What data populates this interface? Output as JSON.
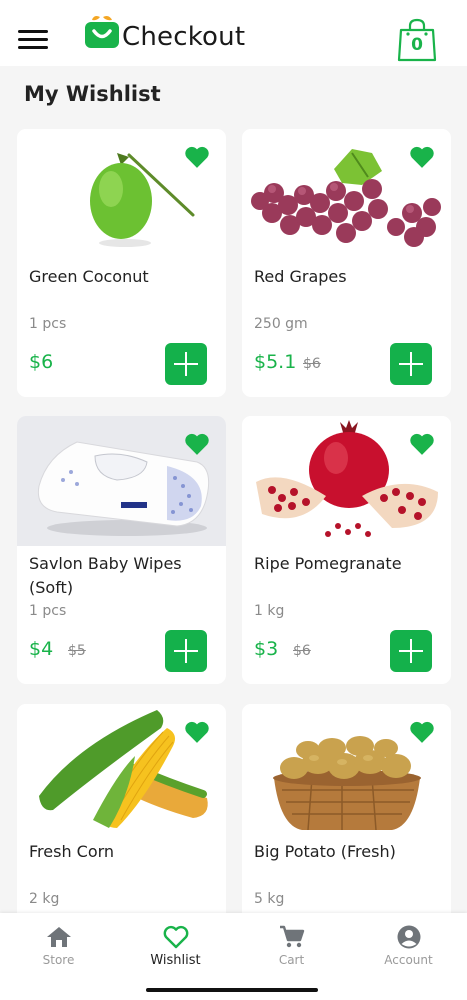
{
  "header": {
    "logo_text": "Checkout",
    "cart_count": "0",
    "brand_color": "#19b34a"
  },
  "page": {
    "title": "My Wishlist"
  },
  "products": [
    {
      "name": "Green Coconut",
      "quantity": "1 pcs",
      "price": "$6",
      "old_price": "",
      "image": "coconut-image",
      "favorited": true
    },
    {
      "name": "Red Grapes",
      "quantity": "250 gm",
      "price": "$5.1",
      "old_price": "$6",
      "image": "grapes-image",
      "favorited": true
    },
    {
      "name": "Savlon Baby Wipes (Soft)",
      "quantity": "1 pcs",
      "price": "$4",
      "old_price": "$5",
      "image": "baby-wipes-image",
      "favorited": true
    },
    {
      "name": "Ripe Pomegranate",
      "quantity": "1 kg",
      "price": "$3",
      "old_price": "$6",
      "image": "pomegranate-image",
      "favorited": true
    },
    {
      "name": "Fresh Corn",
      "quantity": "2 kg",
      "price": "",
      "old_price": "",
      "image": "corn-image",
      "favorited": true
    },
    {
      "name": "Big Potato (Fresh)",
      "quantity": "5 kg",
      "price": "",
      "old_price": "",
      "image": "potato-image",
      "favorited": true
    }
  ],
  "bottom_nav": [
    {
      "label": "Store",
      "icon": "home-icon",
      "active": false
    },
    {
      "label": "Wishlist",
      "icon": "heart-outline-icon",
      "active": true
    },
    {
      "label": "Cart",
      "icon": "cart-icon",
      "active": false
    },
    {
      "label": "Account",
      "icon": "account-icon",
      "active": false
    }
  ]
}
